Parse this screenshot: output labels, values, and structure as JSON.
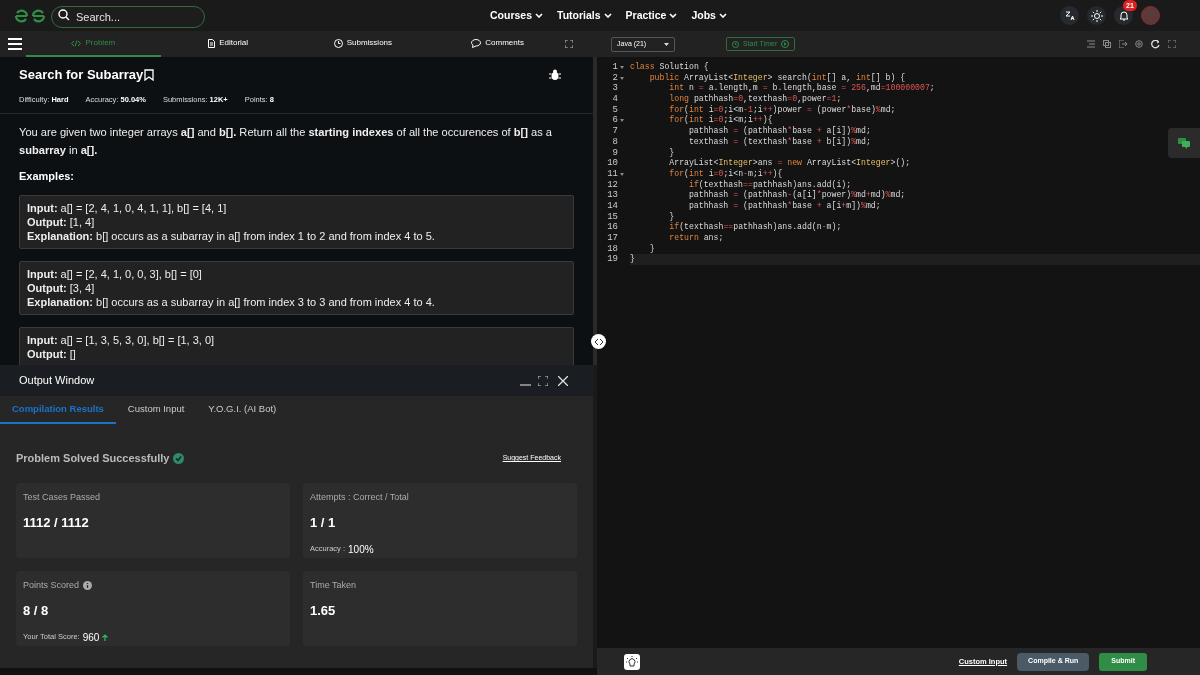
{
  "nav": {
    "search_placeholder": "Search...",
    "menus": [
      "Courses",
      "Tutorials",
      "Practice",
      "Jobs"
    ],
    "notification_count": "21"
  },
  "problem_tabs": [
    {
      "label": "Problem",
      "selected": true
    },
    {
      "label": "Editorial",
      "selected": false
    },
    {
      "label": "Submissions",
      "selected": false
    },
    {
      "label": "Comments",
      "selected": false
    }
  ],
  "problem": {
    "title": "Search for Subarray",
    "meta": [
      {
        "label": "Difficulty:",
        "value": "Hard"
      },
      {
        "label": "Accuracy:",
        "value": "50.04%"
      },
      {
        "label": "Submissions:",
        "value": "12K+"
      },
      {
        "label": "Points:",
        "value": "8"
      }
    ],
    "description": "You are given two integer arrays **a[]** and **b[].** Return all the **starting indexes** of all the occurences of **b[]** as a **subarray** in **a[].**",
    "examples_heading": "Examples:",
    "examples": [
      {
        "lines": [
          "**Input:** a[] = [2, 4, 1, 0, 4, 1, 1], b[] = [4, 1]",
          "**Output:** [1, 4]",
          "**Explanation:** b[] occurs as a subarray in a[] from index 1 to 2 and from index 4 to 5."
        ]
      },
      {
        "lines": [
          "**Input:** a[] = [2, 4, 1, 0, 0, 3], b[] = [0]",
          "**Output:** [3, 4]",
          "**Explanation:** b[] occurs as a subarray in a[] from index 3 to 3 and from index 4 to 4."
        ]
      },
      {
        "lines": [
          "**Input:** a[] = [1, 3, 5, 3, 0], b[] = [1, 3, 0]",
          "**Output:** []"
        ]
      }
    ]
  },
  "output_window": {
    "title": "Output Window",
    "tabs": [
      {
        "label": "Compilation Results",
        "selected": true
      },
      {
        "label": "Custom Input",
        "selected": false
      },
      {
        "label": "Y.O.G.I. (AI Bot)",
        "selected": false
      }
    ],
    "status": "Problem Solved Successfully",
    "feedback_link": "Suggest Feedback",
    "cards": [
      {
        "label": "Test Cases Passed",
        "value": "1112 / 1112",
        "info": false
      },
      {
        "label": "Attempts : Correct / Total",
        "value": "1 / 1",
        "sub_label": "Accuracy :",
        "sub_value": "100%",
        "info": false
      },
      {
        "label": "Points Scored",
        "value": "8 / 8",
        "sub_label": "Your Total Score:",
        "sub_value": "960",
        "info": true,
        "score_increased": true
      },
      {
        "label": "Time Taken",
        "value": "1.65",
        "info": false
      }
    ]
  },
  "editor": {
    "language": "Java (21)",
    "timer_button": "Start Timer",
    "lines": [
      {
        "number": "1",
        "code": "class Solution {",
        "foldable": true
      },
      {
        "number": "2",
        "code": "    public ArrayList<Integer> search(int[] a, int[] b) {",
        "foldable": true
      },
      {
        "number": "3",
        "code": "        int n = a.length,m = b.length,base = 256,md=100000007;",
        "foldable": false
      },
      {
        "number": "4",
        "code": "        long pathhash=0,texthash=0,power=1;",
        "foldable": false
      },
      {
        "number": "5",
        "code": "        for(int i=0;i<m-1;i++)power = (power*base)%md;",
        "foldable": false
      },
      {
        "number": "6",
        "code": "        for(int i=0;i<m;i++){",
        "foldable": true
      },
      {
        "number": "7",
        "code": "            pathhash = (pathhash*base + a[i])%md;",
        "foldable": false
      },
      {
        "number": "8",
        "code": "            texthash = (texthash*base + b[i])%md;",
        "foldable": false
      },
      {
        "number": "9",
        "code": "        }",
        "foldable": false
      },
      {
        "number": "10",
        "code": "        ArrayList<Integer>ans = new ArrayList<Integer>();",
        "foldable": false
      },
      {
        "number": "11",
        "code": "        for(int i=0;i<n-m;i++){",
        "foldable": true
      },
      {
        "number": "12",
        "code": "            if(texthash==pathhash)ans.add(i);",
        "foldable": false
      },
      {
        "number": "13",
        "code": "            pathhash = (pathhash-(a[i]*power)%md+md)%md;",
        "foldable": false
      },
      {
        "number": "14",
        "code": "            pathhash = (pathhash*base + a[i+m])%md;",
        "foldable": false
      },
      {
        "number": "15",
        "code": "        }",
        "foldable": false
      },
      {
        "number": "16",
        "code": "        if(texthash==pathhash)ans.add(n-m);",
        "foldable": false
      },
      {
        "number": "17",
        "code": "        return ans;",
        "foldable": false
      },
      {
        "number": "18",
        "code": "    }",
        "foldable": false
      },
      {
        "number": "19",
        "code": "}",
        "foldable": false
      }
    ]
  },
  "footer": {
    "custom_input": "Custom Input",
    "compile_button": "Compile & Run",
    "submit_button": "Submit"
  }
}
